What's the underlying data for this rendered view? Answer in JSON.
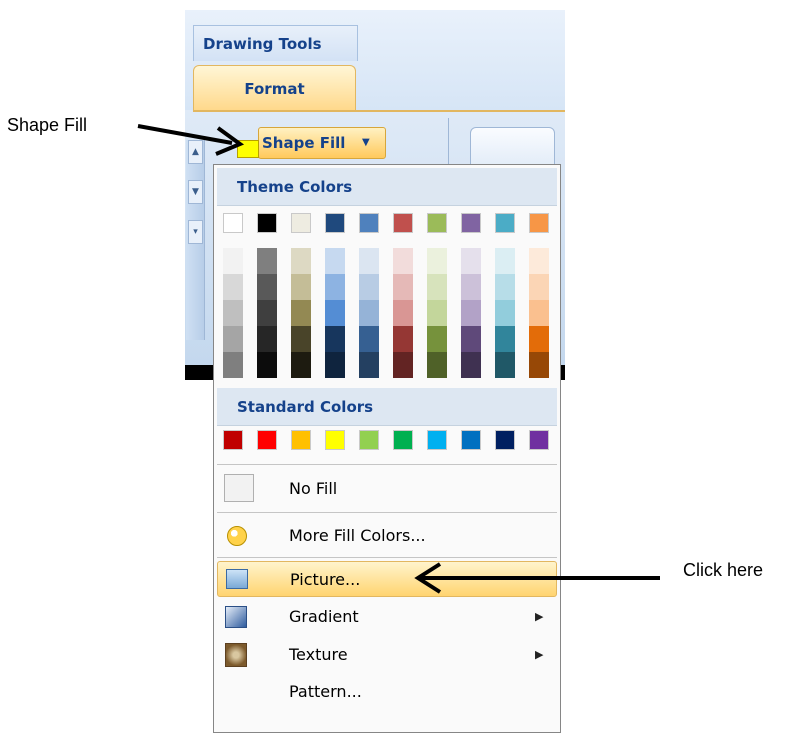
{
  "ribbon": {
    "context_tab": "Drawing Tools",
    "active_tab": "Format",
    "shape_fill_label": "Shape Fill",
    "fill_color": "#ffff00"
  },
  "menu": {
    "theme_colors_header": "Theme Colors",
    "theme_base": [
      "#ffffff",
      "#000000",
      "#eeece1",
      "#1f497d",
      "#4f81bd",
      "#c0504d",
      "#9bbb59",
      "#8064a2",
      "#4bacc6",
      "#f79646"
    ],
    "theme_shades": [
      [
        "#f2f2f2",
        "#d8d8d8",
        "#bfbfbf",
        "#a5a5a5",
        "#7f7f7f"
      ],
      [
        "#7f7f7f",
        "#595959",
        "#3f3f3f",
        "#262626",
        "#0c0c0c"
      ],
      [
        "#ddd9c3",
        "#c4bd97",
        "#938953",
        "#494429",
        "#1d1b10"
      ],
      [
        "#c6d9f0",
        "#8db3e2",
        "#548dd4",
        "#17365d",
        "#0f243e"
      ],
      [
        "#dbe5f1",
        "#b8cce4",
        "#95b3d7",
        "#366092",
        "#244061"
      ],
      [
        "#f2dcdb",
        "#e5b9b7",
        "#d99694",
        "#953734",
        "#632423"
      ],
      [
        "#ebf1dd",
        "#d7e3bc",
        "#c3d69b",
        "#76923c",
        "#4f6128"
      ],
      [
        "#e5e0ec",
        "#ccc1d9",
        "#b2a2c7",
        "#5f497a",
        "#3f3151"
      ],
      [
        "#dbeef3",
        "#b7dde8",
        "#92cddc",
        "#31859b",
        "#205867"
      ],
      [
        "#fdeada",
        "#fbd5b5",
        "#fac08f",
        "#e36c09",
        "#974806"
      ]
    ],
    "standard_colors_header": "Standard Colors",
    "standard_colors": [
      "#c00000",
      "#ff0000",
      "#ffc000",
      "#ffff00",
      "#92d050",
      "#00b050",
      "#00b0f0",
      "#0070c0",
      "#002060",
      "#7030a0"
    ],
    "items": {
      "no_fill": "No Fill",
      "more_fill_colors": "More Fill Colors...",
      "picture": "Picture...",
      "gradient": "Gradient",
      "texture": "Texture",
      "pattern": "Pattern..."
    }
  },
  "annotations": {
    "shape_fill": "Shape Fill",
    "click_here": "Click here"
  }
}
